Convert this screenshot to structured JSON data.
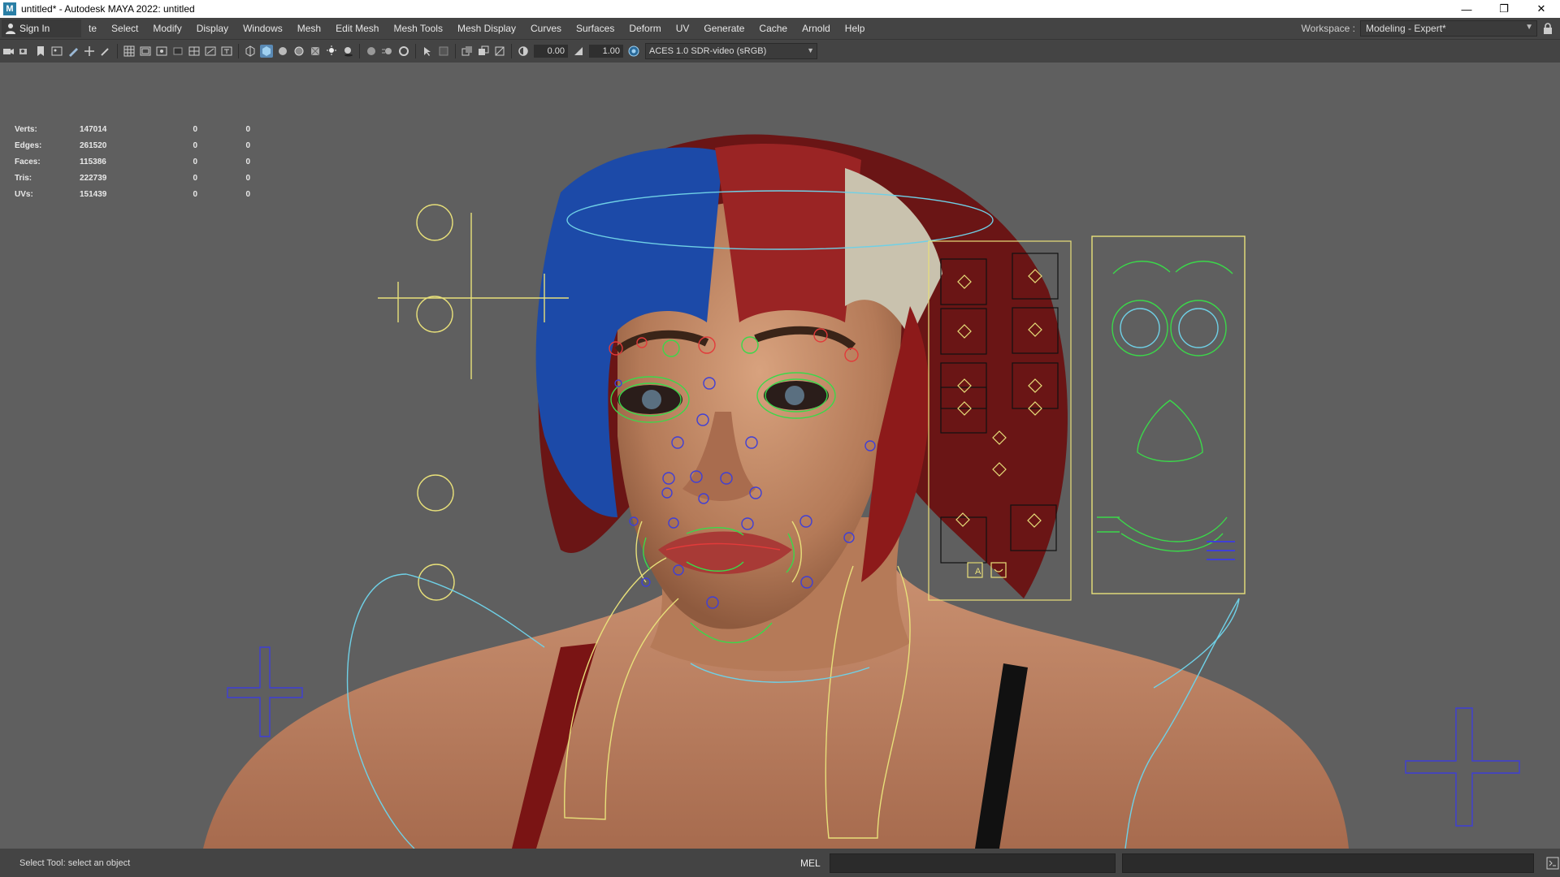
{
  "window": {
    "app_icon": "M",
    "title": "untitled* - Autodesk MAYA 2022: untitled",
    "minimize": "—",
    "restore": "❐",
    "close": "✕"
  },
  "menubar": {
    "signin_label": "Sign In",
    "items": [
      "te",
      "Select",
      "Modify",
      "Display",
      "Windows",
      "Mesh",
      "Edit Mesh",
      "Mesh Tools",
      "Mesh Display",
      "Curves",
      "Surfaces",
      "Deform",
      "UV",
      "Generate",
      "Cache",
      "Arnold",
      "Help"
    ],
    "workspace_label": "Workspace :",
    "workspace_value": "Modeling - Expert*"
  },
  "toolbar": {
    "exposure_value": "0.00",
    "gamma_value": "1.00",
    "colorspace_value": "ACES 1.0 SDR-video (sRGB)"
  },
  "hud": {
    "rows": [
      {
        "label": "Verts:",
        "v1": "147014",
        "v2": "0",
        "v3": "0"
      },
      {
        "label": "Edges:",
        "v1": "261520",
        "v2": "0",
        "v3": "0"
      },
      {
        "label": "Faces:",
        "v1": "115386",
        "v2": "0",
        "v3": "0"
      },
      {
        "label": "Tris:",
        "v1": "222739",
        "v2": "0",
        "v3": "0"
      },
      {
        "label": "UVs:",
        "v1": "151439",
        "v2": "0",
        "v3": "0"
      }
    ]
  },
  "viewport": {
    "camera": "persp",
    "face_panel_letters": [
      "A"
    ]
  },
  "statusbar": {
    "message": "Select Tool: select an object",
    "mel_label": "MEL"
  },
  "colors": {
    "accent": "#5a8ab5",
    "control_yellow": "#e8e07a",
    "control_cyan": "#6fd0e6",
    "control_blue": "#3f3fd6",
    "control_green": "#3bd84a",
    "control_red": "#e23a3a"
  }
}
